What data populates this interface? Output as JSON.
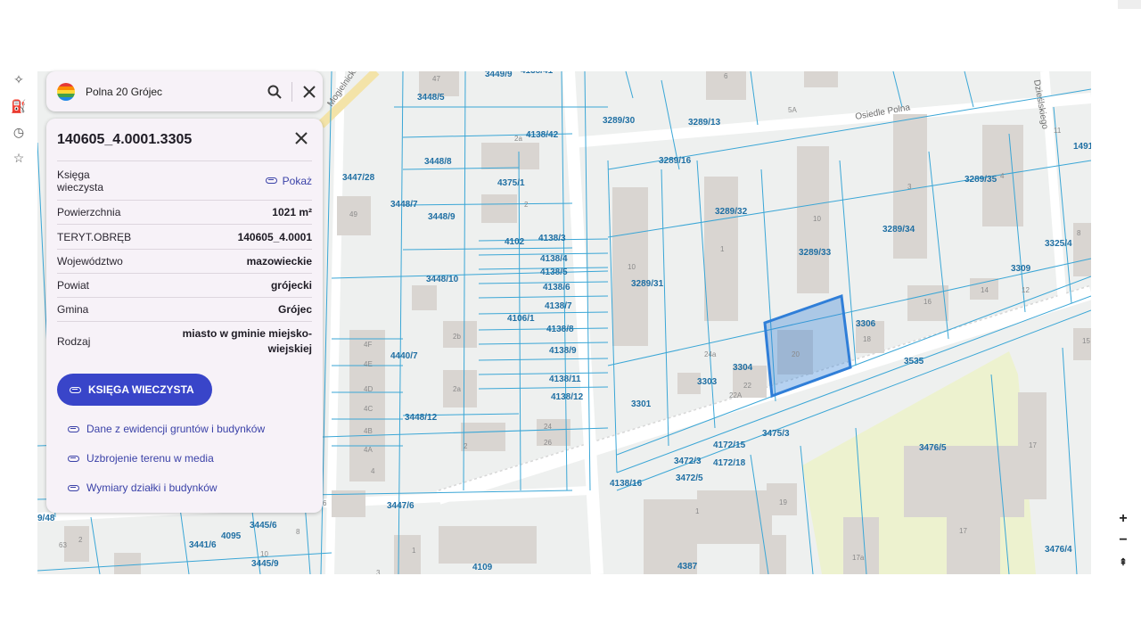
{
  "search": {
    "query": "Polna 20 Grójec"
  },
  "panel": {
    "title": "140605_4.0001.3305",
    "rows": [
      {
        "key": "Księga wieczysta",
        "value": "Pokaż"
      },
      {
        "key": "Powierzchnia",
        "value": "1021 m²"
      },
      {
        "key": "TERYT.OBRĘB",
        "value": "140605_4.0001"
      },
      {
        "key": "Województwo",
        "value": "mazowieckie"
      },
      {
        "key": "Powiat",
        "value": "grójecki"
      },
      {
        "key": "Gmina",
        "value": "Grójec"
      },
      {
        "key": "Rodzaj",
        "value": "miasto w gminie miejsko-wiejskiej"
      }
    ],
    "primary_button": "KSIĘGA WIECZYSTA",
    "links": [
      "Dane z ewidencji gruntów i budynków",
      "Uzbrojenie terenu w media",
      "Wymiary działki i budynków"
    ]
  },
  "map": {
    "highlight_color": "#2f7ed8",
    "line_color": "#3aa6d6",
    "green_area_color": "#edf2cf",
    "streets": [
      "Osiedle Polna",
      "Mogielnicka",
      "Dzieślskiego"
    ],
    "parcel_labels": [
      "3449/9",
      "4138/41",
      "3448/5",
      "3289/30",
      "3289/13",
      "4138/42",
      "3448/8",
      "4375/1",
      "3289/16",
      "3447/28",
      "3448/7",
      "3448/9",
      "3289/32",
      "3289/35",
      "3289/34",
      "4102",
      "4138/3",
      "4138/4",
      "4138/5",
      "4138/6",
      "4138/7",
      "3289/33",
      "3325/4",
      "3309",
      "3448/10",
      "3289/31",
      "4106/1",
      "4138/8",
      "3306",
      "4440/7",
      "4138/9",
      "3304",
      "3535",
      "4138/11",
      "4138/12",
      "3303",
      "3301",
      "3448/12",
      "3475/3",
      "4172/15",
      "3476/5",
      "3472/3",
      "4172/18",
      "3472/5",
      "4138/16",
      "3447/6",
      "3445/6",
      "3441/6",
      "4095",
      "3445/9",
      "4109",
      "4387",
      "3476/4",
      "1491",
      "9/48"
    ],
    "building_numbers": [
      "47",
      "2a",
      "6",
      "5A",
      "10",
      "11",
      "49",
      "2",
      "3",
      "4",
      "8",
      "1",
      "10",
      "14",
      "12",
      "15",
      "16",
      "18",
      "2b",
      "4F",
      "4E",
      "4D",
      "4C",
      "4B",
      "4A",
      "24",
      "26",
      "2a",
      "20",
      "22",
      "22A",
      "24a",
      "2",
      "17",
      "19",
      "1",
      "17a",
      "17",
      "63",
      "2",
      "10",
      "8",
      "3",
      "1",
      "4",
      "6"
    ]
  },
  "zoom": {
    "in": "+",
    "out": "−"
  }
}
